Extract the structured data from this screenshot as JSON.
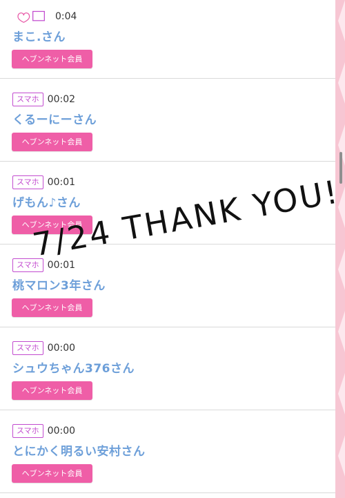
{
  "entries": [
    {
      "device": "",
      "time": "0:04",
      "name": "まこ.さん",
      "member": "ヘブンネット会員"
    },
    {
      "device": "スマホ",
      "time": "00:02",
      "name": "くるーにーさん",
      "member": "ヘブンネット会員"
    },
    {
      "device": "スマホ",
      "time": "00:01",
      "name": "げもん♪さん",
      "member": "ヘブンネット会員"
    },
    {
      "device": "スマホ",
      "time": "00:01",
      "name": "桃マロン3年さん",
      "member": "ヘブンネット会員"
    },
    {
      "device": "スマホ",
      "time": "00:00",
      "name": "シュウちゃん376さん",
      "member": "ヘブンネット会員"
    },
    {
      "device": "スマホ",
      "time": "00:00",
      "name": "とにかく明るい安村さん",
      "member": "ヘブンネット会員"
    }
  ],
  "overlay_text": "7/24 THANK YOU!",
  "colors": {
    "badge": "#c24bcf",
    "name": "#6d9fd9",
    "member_button": "#ef5ea7",
    "rail": "#f7c6d3"
  }
}
